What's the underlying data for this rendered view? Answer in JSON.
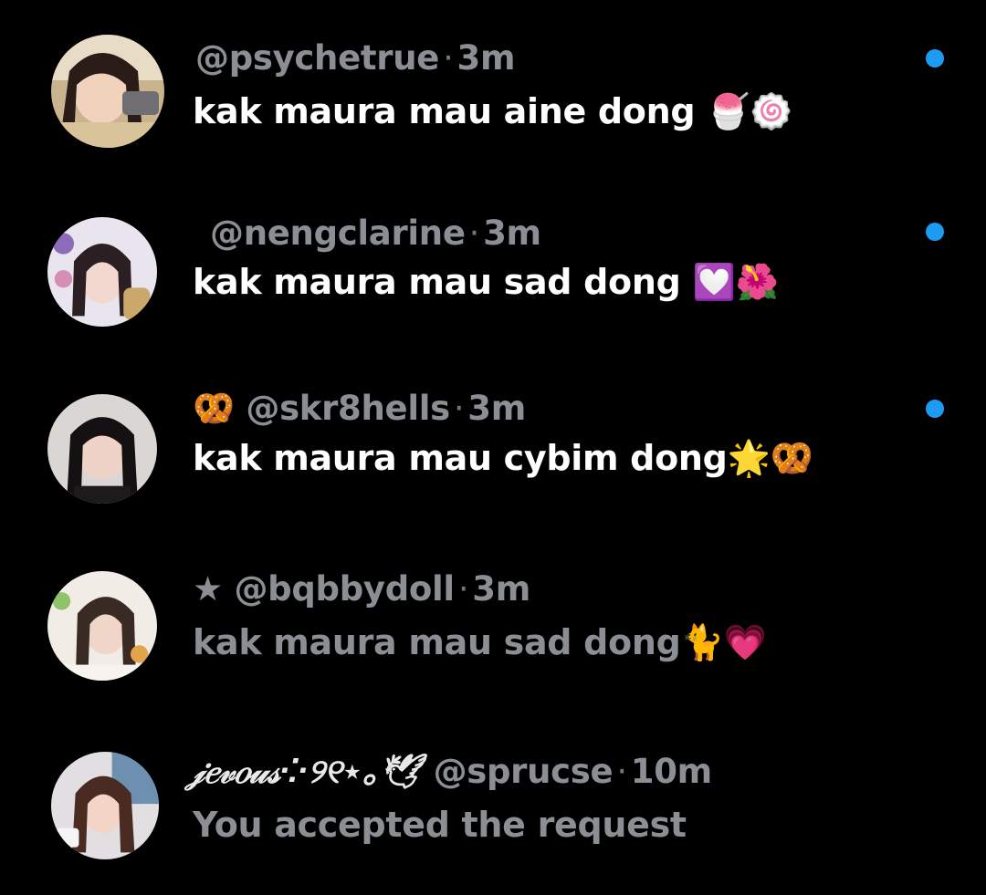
{
  "theme": {
    "background": "#000000",
    "unread_text": "#ffffff",
    "read_text": "#8b8f94",
    "meta_text": "#8b8f94",
    "unread_dot": "#1d9bf0"
  },
  "conversations": [
    {
      "display_name": "",
      "handle": "@psychetrue",
      "separator": "·",
      "time": "3m",
      "message": "kak maura mau aine dong",
      "message_emoji": "🍧🍥",
      "unread": true,
      "avatar_icon": "avatar-photo"
    },
    {
      "display_name": "",
      "handle": "@nengclarine",
      "separator": "·",
      "time": "3m",
      "message": "kak maura mau sad dong",
      "message_emoji": "💟🌺",
      "unread": true,
      "avatar_icon": "avatar-photo"
    },
    {
      "display_name": "🥨",
      "handle": "@skr8hells",
      "separator": "·",
      "time": "3m",
      "message": "kak maura mau cybim dong",
      "message_emoji": "🌟🥨",
      "unread": true,
      "avatar_icon": "avatar-photo"
    },
    {
      "display_name": "★",
      "handle": "@bqbbydoll",
      "separator": "·",
      "time": "3m",
      "message": "kak maura mau sad dong",
      "message_emoji": "🐈💗",
      "unread": false,
      "avatar_icon": "avatar-photo"
    },
    {
      "display_name": "𝒿𝑒𝓋𝑜𝓊𝓈⁘୨୧⋆｡🕊",
      "handle": "@sprucse",
      "separator": "·",
      "time": "10m",
      "message": "You accepted the request",
      "message_emoji": "",
      "unread": false,
      "avatar_icon": "avatar-photo"
    }
  ]
}
